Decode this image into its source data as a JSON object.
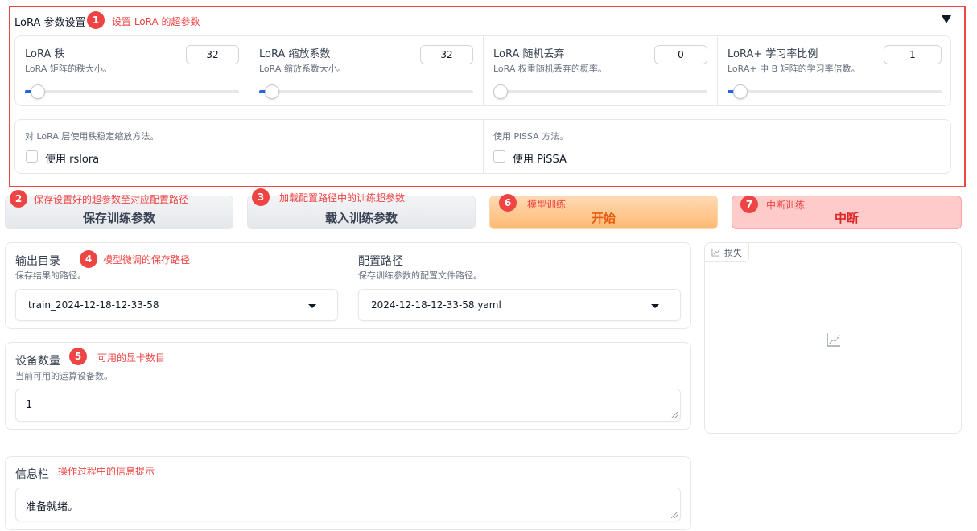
{
  "lora_panel": {
    "title": "LoRA 参数设置",
    "collapse_icon": "triangle-down-icon",
    "sliders": [
      {
        "label": "LoRA 秩",
        "info": "LoRA 矩阵的秩大小。",
        "value": "32",
        "fraction": 0.03
      },
      {
        "label": "LoRA 缩放系数",
        "info": "LoRA 缩放系数大小。",
        "value": "32",
        "fraction": 0.03
      },
      {
        "label": "LoRA 随机丢弃",
        "info": "LoRA 权重随机丢弃的概率。",
        "value": "0",
        "fraction": 0.0
      },
      {
        "label": "LoRA+ 学习率比例",
        "info": "LoRA+ 中 B 矩阵的学习率倍数。",
        "value": "1",
        "fraction": 0.03
      }
    ],
    "checkboxes": [
      {
        "info": "对 LoRA 层使用秩稳定缩放方法。",
        "label": "使用 rslora",
        "checked": false
      },
      {
        "info": "使用 PiSSA 方法。",
        "label": "使用 PiSSA",
        "checked": false
      }
    ]
  },
  "buttons": {
    "save": "保存训练参数",
    "load": "载入训练参数",
    "start": "开始",
    "stop": "中断"
  },
  "output_dir": {
    "label": "输出目录",
    "info": "保存结果的路径。",
    "value": "train_2024-12-18-12-33-58"
  },
  "config_path": {
    "label": "配置路径",
    "info": "保存训练参数的配置文件路径。",
    "value": "2024-12-18-12-33-58.yaml"
  },
  "device_count": {
    "label": "设备数量",
    "info": "当前可用的运算设备数。",
    "value": "1"
  },
  "info_box": {
    "label": "信息栏",
    "value": "准备就绪。"
  },
  "loss_plot": {
    "label": "损失",
    "icon": "chart-icon"
  },
  "annotations": [
    {
      "num": "1",
      "text": "设置 LoRA 的超参数"
    },
    {
      "num": "2",
      "text": "保存设置好的超参数至对应配置路径"
    },
    {
      "num": "3",
      "text": "加载配置路径中的训练超参数"
    },
    {
      "num": "4",
      "text": "模型微调的保存路径"
    },
    {
      "num": "5",
      "text": "可用的显卡数目"
    },
    {
      "num": "6",
      "text": "模型训练"
    },
    {
      "num": "7",
      "text": "中断训练"
    },
    {
      "num": "",
      "text": "操作过程中的信息提示"
    }
  ],
  "colors": {
    "annotation": "#ef4444",
    "primary_button": "#fdba74",
    "stop_button": "#fecaca",
    "slider_fill": "#2563eb"
  }
}
